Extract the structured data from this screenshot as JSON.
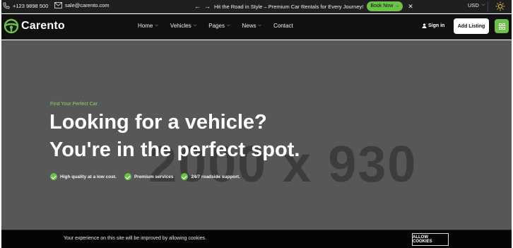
{
  "topbar": {
    "phone": "+123 9898 500",
    "email": "sale@carento.com",
    "promo": "Hit the Road in Style – Premium Car Rentals for Every Journey!",
    "book_label": "Book Now →",
    "currency": "USD"
  },
  "header": {
    "logo": "Carento",
    "nav": [
      "Home",
      "Vehicles",
      "Pages",
      "News",
      "Contact"
    ],
    "signin": "Sign in",
    "add_listing": "Add Listing"
  },
  "hero": {
    "placeholder": "2000 x 930",
    "eyebrow": "Find Your Perfect Car",
    "headline_1": "Looking for a vehicle?",
    "headline_2": "You're in the perfect spot.",
    "features": [
      "High quality at a low cost.",
      "Premium services",
      "24/7 roadside support."
    ]
  },
  "cookie": {
    "text": "Your experience on this site will be improved by allowing cookies.",
    "button": "ALLOW COOKIES"
  },
  "colors": {
    "accent": "#6dc04a",
    "hero_bg": "#575757",
    "header_bg": "#101010"
  }
}
